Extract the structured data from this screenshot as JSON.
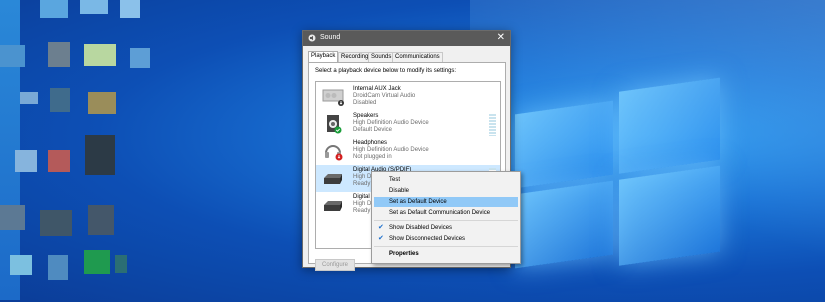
{
  "desktop": {
    "accent": "#0b57c7"
  },
  "dialog": {
    "title": "Sound",
    "tabs": [
      {
        "label": "Playback"
      },
      {
        "label": "Recording"
      },
      {
        "label": "Sounds"
      },
      {
        "label": "Communications"
      }
    ],
    "instruction": "Select a playback device below to modify its settings:",
    "devices": [
      {
        "name": "Internal AUX Jack",
        "desc": "DroidCam Virtual Audio",
        "status": "Disabled",
        "icon": "aux-jack-icon"
      },
      {
        "name": "Speakers",
        "desc": "High Definition Audio Device",
        "status": "Default Device",
        "icon": "speakers-icon"
      },
      {
        "name": "Headphones",
        "desc": "High Definition Audio Device",
        "status": "Not plugged in",
        "icon": "headphones-icon"
      },
      {
        "name": "Digital Audio (S/PDIF)",
        "desc": "High Definition Audio Device",
        "status": "Ready",
        "icon": "spdif-icon"
      },
      {
        "name": "Digital A",
        "desc": "High De",
        "status": "Ready",
        "icon": "spdif-icon"
      }
    ],
    "configure_label": "Configure"
  },
  "context_menu": {
    "items": [
      {
        "label": "Test"
      },
      {
        "label": "Disable"
      },
      {
        "label": "Set as Default Device"
      },
      {
        "label": "Set as Default Communication Device"
      },
      {
        "label": "Show Disabled Devices",
        "checked": true
      },
      {
        "label": "Show Disconnected Devices",
        "checked": true
      },
      {
        "label": "Properties"
      }
    ]
  }
}
